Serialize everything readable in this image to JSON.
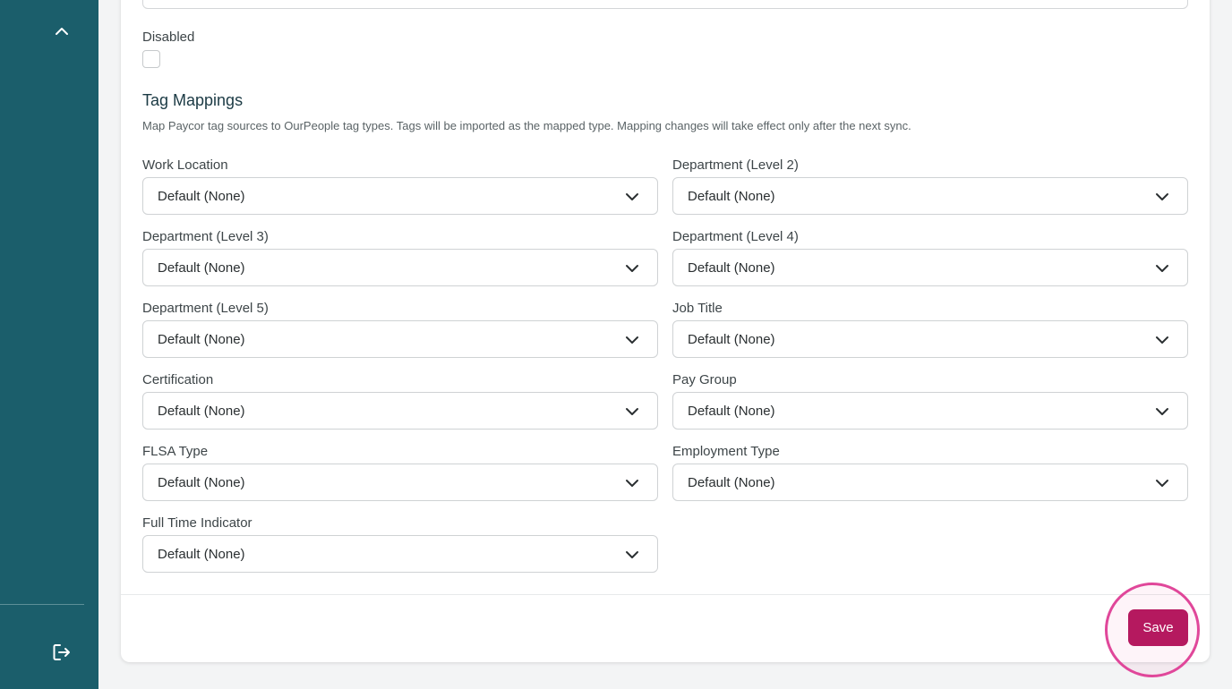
{
  "sidebar": {
    "collapse_icon": "chevron-up-icon",
    "logout_icon": "logout-icon"
  },
  "form": {
    "disabled_label": "Disabled",
    "disabled_checked": false
  },
  "tag_mappings": {
    "title": "Tag Mappings",
    "description": "Map Paycor tag sources to OurPeople tag types. Tags will be imported as the mapped type. Mapping changes will take effect only after the next sync.",
    "fields": [
      {
        "label": "Work Location",
        "value": "Default (None)"
      },
      {
        "label": "Department (Level 2)",
        "value": "Default (None)"
      },
      {
        "label": "Department (Level 3)",
        "value": "Default (None)"
      },
      {
        "label": "Department (Level 4)",
        "value": "Default (None)"
      },
      {
        "label": "Department (Level 5)",
        "value": "Default (None)"
      },
      {
        "label": "Job Title",
        "value": "Default (None)"
      },
      {
        "label": "Certification",
        "value": "Default (None)"
      },
      {
        "label": "Pay Group",
        "value": "Default (None)"
      },
      {
        "label": "FLSA Type",
        "value": "Default (None)"
      },
      {
        "label": "Employment Type",
        "value": "Default (None)"
      },
      {
        "label": "Full Time Indicator",
        "value": "Default (None)"
      }
    ]
  },
  "footer": {
    "save_label": "Save"
  },
  "colors": {
    "sidebar": "#1b5e6b",
    "save_button": "#b5195f",
    "highlight": "#e0479a"
  }
}
